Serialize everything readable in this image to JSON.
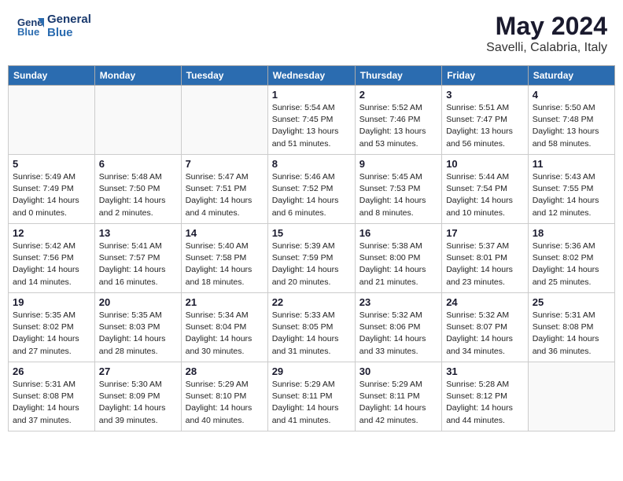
{
  "header": {
    "logo_line1": "General",
    "logo_line2": "Blue",
    "main_title": "May 2024",
    "subtitle": "Savelli, Calabria, Italy"
  },
  "days_of_week": [
    "Sunday",
    "Monday",
    "Tuesday",
    "Wednesday",
    "Thursday",
    "Friday",
    "Saturday"
  ],
  "weeks": [
    [
      {
        "day": "",
        "info": ""
      },
      {
        "day": "",
        "info": ""
      },
      {
        "day": "",
        "info": ""
      },
      {
        "day": "1",
        "info": "Sunrise: 5:54 AM\nSunset: 7:45 PM\nDaylight: 13 hours\nand 51 minutes."
      },
      {
        "day": "2",
        "info": "Sunrise: 5:52 AM\nSunset: 7:46 PM\nDaylight: 13 hours\nand 53 minutes."
      },
      {
        "day": "3",
        "info": "Sunrise: 5:51 AM\nSunset: 7:47 PM\nDaylight: 13 hours\nand 56 minutes."
      },
      {
        "day": "4",
        "info": "Sunrise: 5:50 AM\nSunset: 7:48 PM\nDaylight: 13 hours\nand 58 minutes."
      }
    ],
    [
      {
        "day": "5",
        "info": "Sunrise: 5:49 AM\nSunset: 7:49 PM\nDaylight: 14 hours\nand 0 minutes."
      },
      {
        "day": "6",
        "info": "Sunrise: 5:48 AM\nSunset: 7:50 PM\nDaylight: 14 hours\nand 2 minutes."
      },
      {
        "day": "7",
        "info": "Sunrise: 5:47 AM\nSunset: 7:51 PM\nDaylight: 14 hours\nand 4 minutes."
      },
      {
        "day": "8",
        "info": "Sunrise: 5:46 AM\nSunset: 7:52 PM\nDaylight: 14 hours\nand 6 minutes."
      },
      {
        "day": "9",
        "info": "Sunrise: 5:45 AM\nSunset: 7:53 PM\nDaylight: 14 hours\nand 8 minutes."
      },
      {
        "day": "10",
        "info": "Sunrise: 5:44 AM\nSunset: 7:54 PM\nDaylight: 14 hours\nand 10 minutes."
      },
      {
        "day": "11",
        "info": "Sunrise: 5:43 AM\nSunset: 7:55 PM\nDaylight: 14 hours\nand 12 minutes."
      }
    ],
    [
      {
        "day": "12",
        "info": "Sunrise: 5:42 AM\nSunset: 7:56 PM\nDaylight: 14 hours\nand 14 minutes."
      },
      {
        "day": "13",
        "info": "Sunrise: 5:41 AM\nSunset: 7:57 PM\nDaylight: 14 hours\nand 16 minutes."
      },
      {
        "day": "14",
        "info": "Sunrise: 5:40 AM\nSunset: 7:58 PM\nDaylight: 14 hours\nand 18 minutes."
      },
      {
        "day": "15",
        "info": "Sunrise: 5:39 AM\nSunset: 7:59 PM\nDaylight: 14 hours\nand 20 minutes."
      },
      {
        "day": "16",
        "info": "Sunrise: 5:38 AM\nSunset: 8:00 PM\nDaylight: 14 hours\nand 21 minutes."
      },
      {
        "day": "17",
        "info": "Sunrise: 5:37 AM\nSunset: 8:01 PM\nDaylight: 14 hours\nand 23 minutes."
      },
      {
        "day": "18",
        "info": "Sunrise: 5:36 AM\nSunset: 8:02 PM\nDaylight: 14 hours\nand 25 minutes."
      }
    ],
    [
      {
        "day": "19",
        "info": "Sunrise: 5:35 AM\nSunset: 8:02 PM\nDaylight: 14 hours\nand 27 minutes."
      },
      {
        "day": "20",
        "info": "Sunrise: 5:35 AM\nSunset: 8:03 PM\nDaylight: 14 hours\nand 28 minutes."
      },
      {
        "day": "21",
        "info": "Sunrise: 5:34 AM\nSunset: 8:04 PM\nDaylight: 14 hours\nand 30 minutes."
      },
      {
        "day": "22",
        "info": "Sunrise: 5:33 AM\nSunset: 8:05 PM\nDaylight: 14 hours\nand 31 minutes."
      },
      {
        "day": "23",
        "info": "Sunrise: 5:32 AM\nSunset: 8:06 PM\nDaylight: 14 hours\nand 33 minutes."
      },
      {
        "day": "24",
        "info": "Sunrise: 5:32 AM\nSunset: 8:07 PM\nDaylight: 14 hours\nand 34 minutes."
      },
      {
        "day": "25",
        "info": "Sunrise: 5:31 AM\nSunset: 8:08 PM\nDaylight: 14 hours\nand 36 minutes."
      }
    ],
    [
      {
        "day": "26",
        "info": "Sunrise: 5:31 AM\nSunset: 8:08 PM\nDaylight: 14 hours\nand 37 minutes."
      },
      {
        "day": "27",
        "info": "Sunrise: 5:30 AM\nSunset: 8:09 PM\nDaylight: 14 hours\nand 39 minutes."
      },
      {
        "day": "28",
        "info": "Sunrise: 5:29 AM\nSunset: 8:10 PM\nDaylight: 14 hours\nand 40 minutes."
      },
      {
        "day": "29",
        "info": "Sunrise: 5:29 AM\nSunset: 8:11 PM\nDaylight: 14 hours\nand 41 minutes."
      },
      {
        "day": "30",
        "info": "Sunrise: 5:29 AM\nSunset: 8:11 PM\nDaylight: 14 hours\nand 42 minutes."
      },
      {
        "day": "31",
        "info": "Sunrise: 5:28 AM\nSunset: 8:12 PM\nDaylight: 14 hours\nand 44 minutes."
      },
      {
        "day": "",
        "info": ""
      }
    ]
  ]
}
